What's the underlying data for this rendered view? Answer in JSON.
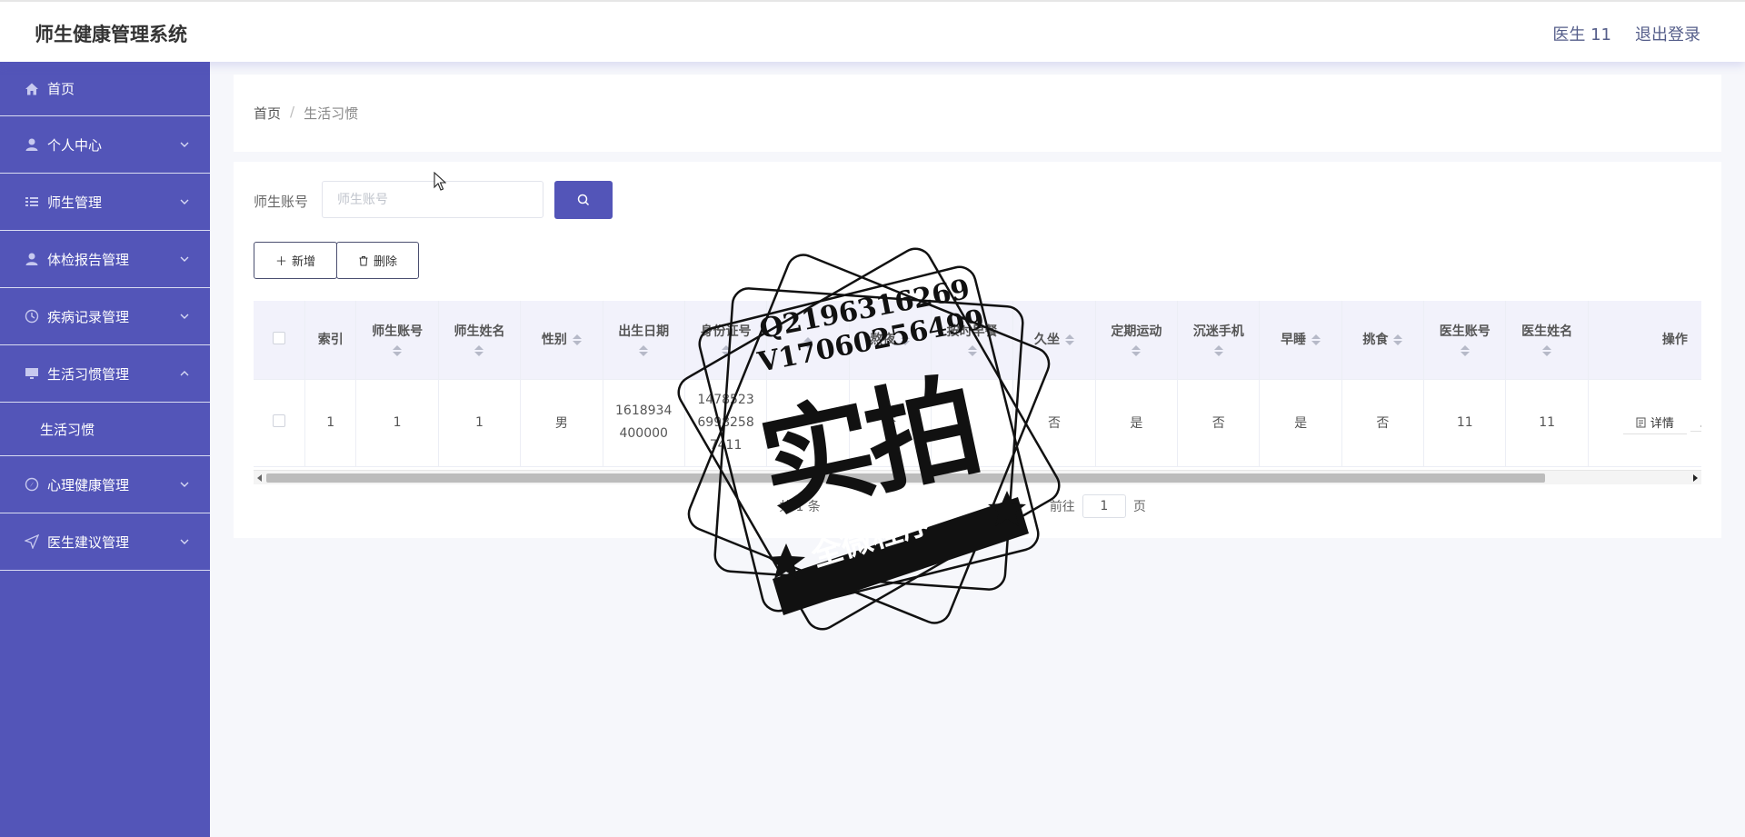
{
  "app": {
    "title": "师生健康管理系统"
  },
  "header": {
    "user": "医生 11",
    "logout": "退出登录"
  },
  "sidebar": {
    "items": [
      {
        "label": "首页",
        "icon": "home-icon"
      },
      {
        "label": "个人中心",
        "icon": "user-icon"
      },
      {
        "label": "师生管理",
        "icon": "list-icon"
      },
      {
        "label": "体检报告管理",
        "icon": "user-icon"
      },
      {
        "label": "疾病记录管理",
        "icon": "clock-icon"
      },
      {
        "label": "生活习惯管理",
        "icon": "monitor-icon",
        "expanded": true,
        "children": [
          "生活习惯"
        ]
      },
      {
        "label": "心理健康管理",
        "icon": "compass-icon"
      },
      {
        "label": "医生建议管理",
        "icon": "send-icon"
      }
    ]
  },
  "breadcrumb": {
    "home": "首页",
    "separator": "/",
    "current": "生活习惯"
  },
  "search": {
    "label": "师生账号",
    "placeholder": "师生账号"
  },
  "toolbar": {
    "add": "新增",
    "delete": "删除"
  },
  "table": {
    "columns": [
      "索引",
      "师生账号",
      "师生姓名",
      "性别",
      "出生日期",
      "身份证号",
      "",
      "熬夜",
      "按时早餐",
      "久坐",
      "定期运动",
      "沉迷手机",
      "早睡",
      "挑食",
      "医生账号",
      "医生姓名",
      "操作"
    ],
    "rows": [
      {
        "index": "1",
        "account": "1",
        "name": "1",
        "gender": "男",
        "birth_line1": "1618934",
        "birth_line2": "400000",
        "id_line1": "1478523",
        "id_line2": "6998258",
        "id_line3": "7411",
        "hidden_col": "",
        "stay_up": "否",
        "breakfast": "",
        "sedentary": "否",
        "exercise": "是",
        "phone": "否",
        "sleep_early": "是",
        "picky": "否",
        "doctor_account": "11",
        "doctor_name": "11",
        "detail": "详情"
      }
    ]
  },
  "pager": {
    "total": "共 1 条",
    "goto": "前往",
    "page": "1",
    "page_unit": "页"
  },
  "watermark": {
    "line1": "Q2196316269",
    "line2": "V17060256499",
    "big": "实拍",
    "band": "全微程序"
  },
  "colors": {
    "primary": "#5355b8",
    "header_bg": "#f2f2fb"
  }
}
